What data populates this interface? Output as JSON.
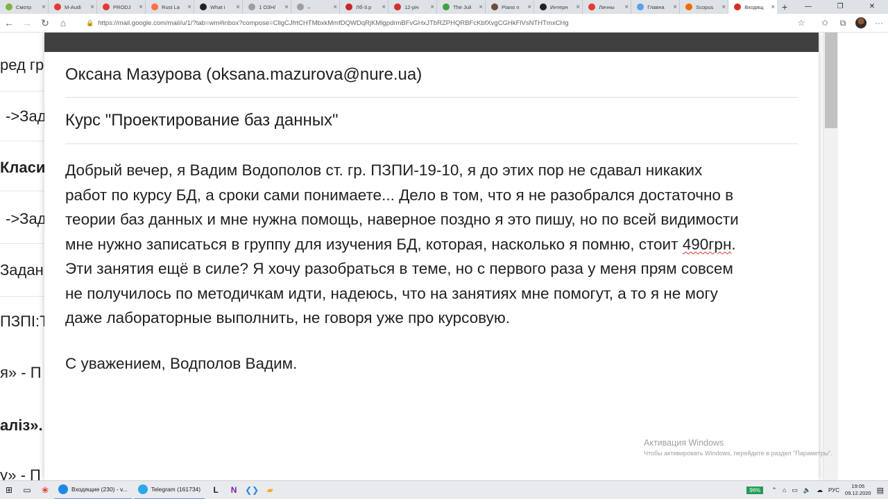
{
  "browser": {
    "tabs": [
      {
        "label": "Смотр",
        "color": "#7cb342",
        "active": false
      },
      {
        "label": "M-Audi",
        "color": "#e53935",
        "active": false
      },
      {
        "label": "PRODJ",
        "color": "#e53935",
        "active": false
      },
      {
        "label": "Rust La",
        "color": "#ff7043",
        "active": false
      },
      {
        "label": "What i",
        "color": "#212121",
        "active": false
      },
      {
        "label": "1 ОЗН/",
        "color": "#9e9e9e",
        "active": false
      },
      {
        "label": "–",
        "color": "#9e9e9e",
        "active": false
      },
      {
        "label": "Лб-3.p",
        "color": "#c62828",
        "active": false
      },
      {
        "label": "12-річ",
        "color": "#d32f2f",
        "active": false
      },
      {
        "label": "The Juli",
        "color": "#43a047",
        "active": false
      },
      {
        "label": "Piano n",
        "color": "#6d4c41",
        "active": false
      },
      {
        "label": "Интерн",
        "color": "#212121",
        "active": false
      },
      {
        "label": "Личны",
        "color": "#e53935",
        "active": false
      },
      {
        "label": "Главна",
        "color": "#5c9ded",
        "active": false
      },
      {
        "label": "Scopus",
        "color": "#ef6c00",
        "active": false
      },
      {
        "label": "Входящ",
        "color": "#d93025",
        "active": true
      }
    ],
    "url": "https://mail.google.com/mail/u/1/?tab=wm#inbox?compose=CllgCJfrtCHTMbxkMmfDQWDqRjKMlgpdrmBFvGHxJTbRZPHQRBFcKbfXvgCGHkFlVsNTHTmxCHg"
  },
  "background_page": {
    "lines": [
      {
        "text": "ред гр",
        "bold": false
      },
      {
        "text": "->Зад",
        "bold": false
      },
      {
        "text": "Класи",
        "bold": true
      },
      {
        "text": "->Зад",
        "bold": false
      },
      {
        "text": "Задан",
        "bold": false
      },
      {
        "text": "ПЗПІ:Т",
        "bold": false
      },
      {
        "text": "я» - П",
        "bold": false
      },
      {
        "text": "аліз».",
        "bold": true
      },
      {
        "text": "у» - П",
        "bold": false
      }
    ]
  },
  "email": {
    "recipient": "Оксана Мазурова (oksana.mazurova@nure.ua)",
    "subject": "Курс \"Проектирование баз данных\"",
    "body_lines": [
      "Добрый вечер, я Вадим Водополов ст. гр. ПЗПИ-19-10, я до этих пор не сдавал никаких",
      "работ по курсу БД, а сроки сами понимаете... Дело в том, что я не разобрался достаточно в",
      "теории баз данных и мне нужна помощь, наверное поздно я это пишу, но по всей видимости",
      "мне нужно записаться в группу для изучения БД, которая, насколько я помню, стоит ",
      "Эти занятия ещё в силе? Я хочу разобраться в теме, но с первого раза у меня прям совсем",
      "не получилось по методичкам идти, надеюсь, что на занятиях мне помогут, а то я не могу",
      "даже лабораторные выполнить, не говоря уже про курсовую."
    ],
    "misspelled_word": "490грн",
    "line4_tail": ".",
    "signature": "С уважением, Водполов Вадим."
  },
  "watermark": {
    "title": "Активация Windows",
    "subtitle": "Чтобы активировать Windows, перейдите в раздел \"Параметры\"."
  },
  "taskbar": {
    "apps": [
      {
        "label": "Входящие (230) - v...",
        "color": "#1e88e5"
      },
      {
        "label": "Telegram (161734)",
        "color": "#29a9eb"
      }
    ],
    "battery": "96%",
    "language": "РУС",
    "time": "19:05",
    "date": "09.12.2020"
  }
}
